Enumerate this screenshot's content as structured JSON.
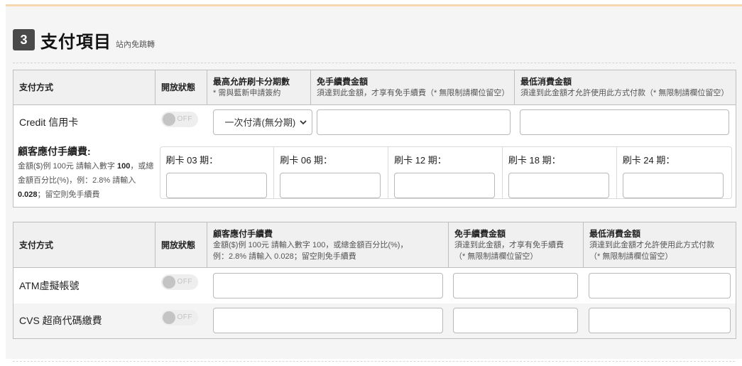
{
  "section": {
    "number": "3",
    "title": "支付項目",
    "subtitle": "站內免跳轉"
  },
  "credit_table": {
    "headers": {
      "method": "支付方式",
      "status": "開放狀態",
      "max_installment": "最高允許刷卡分期數",
      "max_installment_note": "* 需與藍新申請簽約",
      "free_fee": "免手續費金額",
      "free_fee_note": "須達到此金額，才享有免手續費（* 無限制請欄位留空）",
      "min_amount": "最低消費金額",
      "min_amount_note": "須達到此金額才允許使用此方式付款（* 無限制請欄位留空）"
    },
    "row": {
      "method_label": "Credit 信用卡",
      "toggle_label": "OFF",
      "installment_selected": "一次付清(無分期)",
      "free_fee_value": "",
      "min_amount_value": ""
    },
    "installment_fees": {
      "title": "顧客應付手續費:",
      "desc_1": "金額($)例 100元 請輸入數字 ",
      "desc_bold_1": "100",
      "desc_2": "，或總金額百分比(%)，例：2.8% 請輸入 ",
      "desc_bold_2": "0.028",
      "desc_3": "；留空則免手續費",
      "periods": [
        {
          "label": "刷卡 03 期：",
          "value": ""
        },
        {
          "label": "刷卡 06 期：",
          "value": ""
        },
        {
          "label": "刷卡 12 期：",
          "value": ""
        },
        {
          "label": "刷卡 18 期：",
          "value": ""
        },
        {
          "label": "刷卡 24 期：",
          "value": ""
        }
      ]
    }
  },
  "other_table": {
    "headers": {
      "method": "支付方式",
      "status": "開放狀態",
      "customer_fee": "顧客應付手續費",
      "customer_fee_note_1": "金額($)例 100元 請輸入數字 100，或總金額百分比(%)，",
      "customer_fee_note_2": "例：2.8% 請輸入 0.028；留空則免手續費",
      "free_fee": "免手續費金額",
      "free_fee_note_1": "須達到此金額，才享有免手續費",
      "free_fee_note_2": "（* 無限制請欄位留空）",
      "min_amount": "最低消費金額",
      "min_amount_note_1": "須達到此金額才允許使用此方式付款",
      "min_amount_note_2": "（* 無限制請欄位留空）"
    },
    "rows": [
      {
        "label": "ATM虛擬帳號",
        "toggle_label": "OFF",
        "customer_fee": "",
        "free_fee": "",
        "min_amount": ""
      },
      {
        "label": "CVS 超商代碼繳費",
        "toggle_label": "OFF",
        "customer_fee": "",
        "free_fee": "",
        "min_amount": ""
      }
    ]
  },
  "colors": {
    "accent_top_border": "#f7d7b0",
    "badge": "#4a4a4a",
    "header_bg": "#f0f0f0"
  }
}
